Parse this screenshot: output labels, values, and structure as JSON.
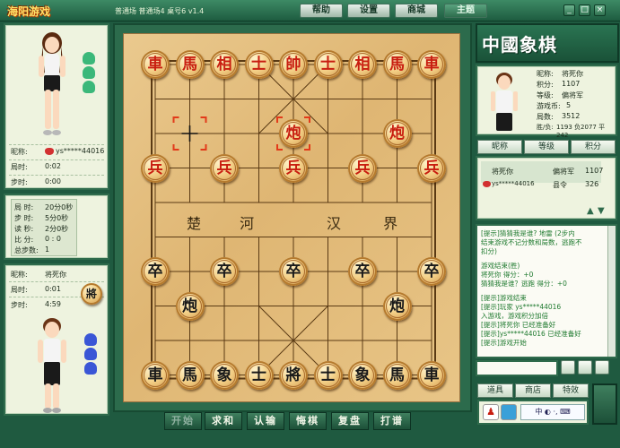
{
  "window": {
    "logo": "海阳游戏",
    "room_title": "普通场 普通场4 桌号6 v1.4",
    "menu": [
      "帮助",
      "设置",
      "商城",
      "主题"
    ],
    "controls": [
      "_",
      "□",
      "×"
    ]
  },
  "top_player": {
    "nick_label": "昵称:",
    "nick_value": "ys*****44016",
    "timer_label": "局时:",
    "timer_value": "0:02",
    "step_label": "步时:",
    "step_value": "0:00"
  },
  "rules": {
    "rows": [
      {
        "label": "局 时:",
        "value": "20分0秒"
      },
      {
        "label": "步 时:",
        "value": "5分0秒"
      },
      {
        "label": "读 秒:",
        "value": "2分0秒"
      },
      {
        "label": "比 分:",
        "value": "0 : 0"
      },
      {
        "label": "总步数:",
        "value": "1"
      }
    ]
  },
  "bottom_player": {
    "nick_label": "昵称:",
    "nick_value": "将死你",
    "timer_label": "局时:",
    "timer_value": "0:01",
    "step_label": "步时:",
    "step_value": "4:59",
    "role_badge": "將"
  },
  "board": {
    "river_left": [
      "楚",
      "河"
    ],
    "river_right": [
      "汉",
      "界"
    ],
    "pieces": [
      {
        "label": "車",
        "side": "red",
        "col": 0,
        "row": 0
      },
      {
        "label": "馬",
        "side": "red",
        "col": 1,
        "row": 0
      },
      {
        "label": "相",
        "side": "red",
        "col": 2,
        "row": 0
      },
      {
        "label": "士",
        "side": "red",
        "col": 3,
        "row": 0
      },
      {
        "label": "帥",
        "side": "red",
        "col": 4,
        "row": 0
      },
      {
        "label": "士",
        "side": "red",
        "col": 5,
        "row": 0
      },
      {
        "label": "相",
        "side": "red",
        "col": 6,
        "row": 0
      },
      {
        "label": "馬",
        "side": "red",
        "col": 7,
        "row": 0
      },
      {
        "label": "車",
        "side": "red",
        "col": 8,
        "row": 0
      },
      {
        "label": "炮",
        "side": "red",
        "col": 4,
        "row": 2
      },
      {
        "label": "炮",
        "side": "red",
        "col": 7,
        "row": 2
      },
      {
        "label": "兵",
        "side": "red",
        "col": 0,
        "row": 3
      },
      {
        "label": "兵",
        "side": "red",
        "col": 2,
        "row": 3
      },
      {
        "label": "兵",
        "side": "red",
        "col": 4,
        "row": 3
      },
      {
        "label": "兵",
        "side": "red",
        "col": 6,
        "row": 3
      },
      {
        "label": "兵",
        "side": "red",
        "col": 8,
        "row": 3
      },
      {
        "label": "卒",
        "side": "black",
        "col": 0,
        "row": 6
      },
      {
        "label": "卒",
        "side": "black",
        "col": 2,
        "row": 6
      },
      {
        "label": "卒",
        "side": "black",
        "col": 4,
        "row": 6
      },
      {
        "label": "卒",
        "side": "black",
        "col": 6,
        "row": 6
      },
      {
        "label": "卒",
        "side": "black",
        "col": 8,
        "row": 6
      },
      {
        "label": "炮",
        "side": "black",
        "col": 1,
        "row": 7
      },
      {
        "label": "炮",
        "side": "black",
        "col": 7,
        "row": 7
      },
      {
        "label": "車",
        "side": "black",
        "col": 0,
        "row": 9
      },
      {
        "label": "馬",
        "side": "black",
        "col": 1,
        "row": 9
      },
      {
        "label": "象",
        "side": "black",
        "col": 2,
        "row": 9
      },
      {
        "label": "士",
        "side": "black",
        "col": 3,
        "row": 9
      },
      {
        "label": "將",
        "side": "black",
        "col": 4,
        "row": 9
      },
      {
        "label": "士",
        "side": "black",
        "col": 5,
        "row": 9
      },
      {
        "label": "象",
        "side": "black",
        "col": 6,
        "row": 9
      },
      {
        "label": "馬",
        "side": "black",
        "col": 7,
        "row": 9
      },
      {
        "label": "車",
        "side": "black",
        "col": 8,
        "row": 9
      }
    ],
    "move_from": {
      "col": 1,
      "row": 2
    },
    "move_to": {
      "col": 4,
      "row": 2
    }
  },
  "toolbar": [
    "开始",
    "求和",
    "认输",
    "悔棋",
    "复盘",
    "打谱"
  ],
  "right_title": "中國象棋",
  "profile": {
    "rows": [
      {
        "label": "昵称:",
        "value": "将死你"
      },
      {
        "label": "积分:",
        "value": "1107"
      },
      {
        "label": "等级:",
        "value": "偏将军"
      },
      {
        "label": "游戏币:",
        "value": "5"
      },
      {
        "label": "局数:",
        "value": "3512"
      },
      {
        "label": "胜/负:",
        "value": "1193 负2077 平242"
      }
    ]
  },
  "players_tabs": [
    "昵称",
    "等级",
    "积分"
  ],
  "players": [
    {
      "name": "将死你",
      "rank": "偏将军",
      "score": "1107"
    },
    {
      "name": "ys*****44016",
      "rank": "县令",
      "score": "326"
    }
  ],
  "chat": [
    {
      "text": "[提示]猜猜我是谁? 地雷 (2步内",
      "color": "green"
    },
    {
      "text": "结束游戏不记分数和局数，逃跑不",
      "color": "green"
    },
    {
      "text": "扣分)",
      "color": "green"
    },
    {
      "text": "游戏结束(胜)",
      "color": "green"
    },
    {
      "text": "将死你 得分：+0",
      "color": "green"
    },
    {
      "text": "猜猜我是谁？逃跑 得分：+0",
      "color": "green"
    },
    {
      "text": "[提示]游戏结束",
      "color": "green"
    },
    {
      "text": "[提示]玩家 ys*****44016",
      "color": "green"
    },
    {
      "text": "入游戏，游戏积分加倍",
      "color": "green"
    },
    {
      "text": "[提示]将死你 已经准备好",
      "color": "green"
    },
    {
      "text": "[提示]ys*****44016 已经准备好",
      "color": "green"
    },
    {
      "text": "[提示]游戏开始",
      "color": "green"
    }
  ],
  "shop_tabs": [
    "道具",
    "商店",
    "特效"
  ],
  "chat_placeholder": "",
  "colors": {
    "frame_green": "#2f6b4c",
    "board_wood": "#dfb673",
    "red_piece": "#c81e10",
    "black_piece": "#1a1a1a"
  }
}
